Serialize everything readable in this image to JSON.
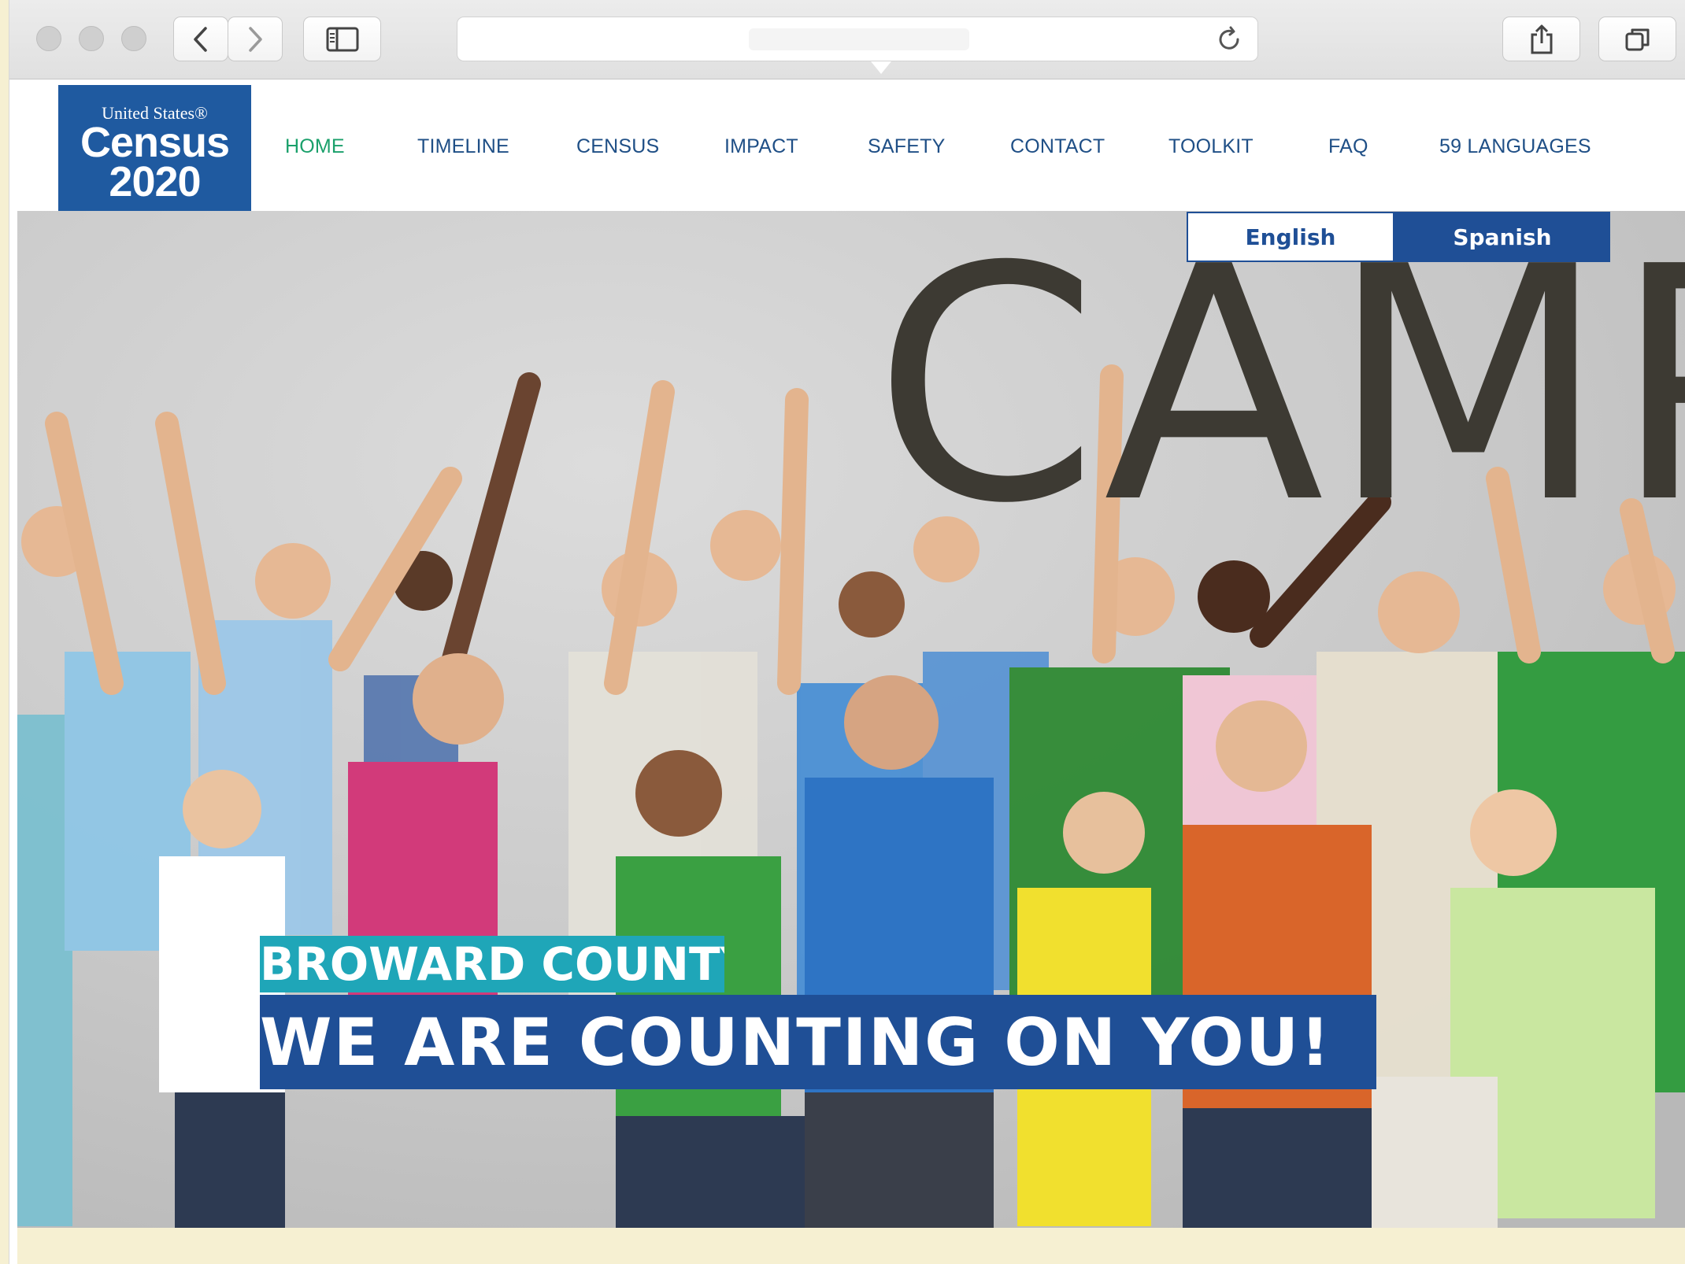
{
  "browser": {
    "toolbar": {
      "back_icon": "chevron-left-icon",
      "forward_icon": "chevron-right-icon",
      "sidebar_icon": "sidebar-icon",
      "reload_icon": "reload-icon",
      "share_icon": "share-icon",
      "tabs_icon": "tabs-icon"
    },
    "url_text": ""
  },
  "site": {
    "logo": {
      "line1": "United States®",
      "line2": "Census",
      "line3": "2020"
    },
    "nav": [
      {
        "label": "HOME",
        "active": true
      },
      {
        "label": "TIMELINE",
        "active": false
      },
      {
        "label": "CENSUS",
        "active": false
      },
      {
        "label": "IMPACT",
        "active": false
      },
      {
        "label": "SAFETY",
        "active": false
      },
      {
        "label": "CONTACT",
        "active": false
      },
      {
        "label": "TOOLKIT",
        "active": false
      },
      {
        "label": "FAQ",
        "active": false
      },
      {
        "label": "59 LANGUAGES",
        "active": false
      }
    ],
    "language": {
      "english": "English",
      "spanish": "Spanish"
    },
    "hero": {
      "big_word": "CAMP",
      "county": "BROWARD COUNTY",
      "tagline": "WE ARE COUNTING ON YOU!",
      "image_desc_icon": "group-of-people-photo"
    }
  },
  "colors": {
    "brand_blue": "#1f4f96",
    "nav_active": "#1aa06b",
    "teal": "#1fa6b8",
    "big_word": "#3d3a33"
  }
}
